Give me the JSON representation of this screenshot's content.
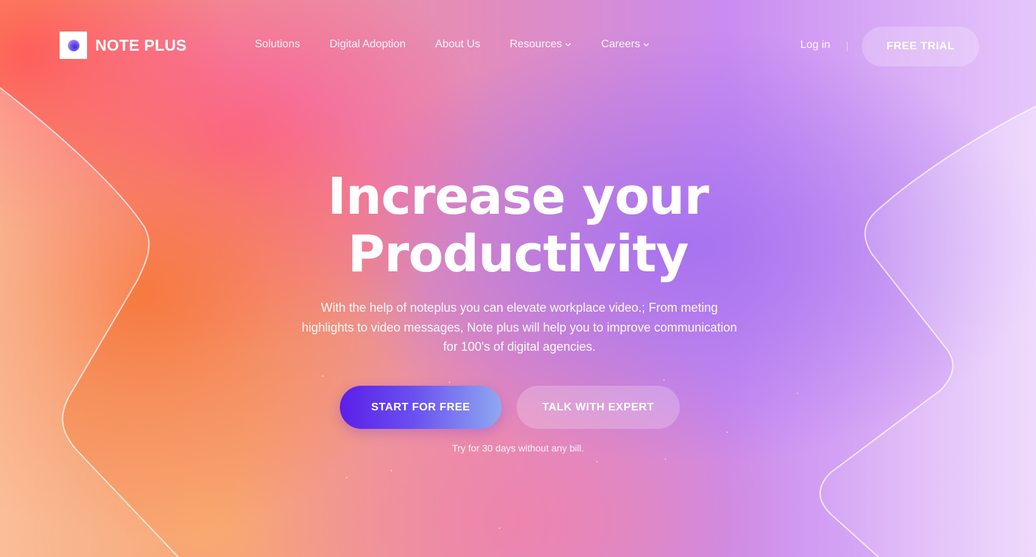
{
  "brand": {
    "name": "NOTE PLUS",
    "logo_icon": "note-plus-logo-icon"
  },
  "nav": {
    "links": [
      {
        "label": "Solutions",
        "has_dropdown": false
      },
      {
        "label": "Digital Adoption",
        "has_dropdown": false
      },
      {
        "label": "About Us",
        "has_dropdown": false
      },
      {
        "label": "Resources",
        "has_dropdown": true
      },
      {
        "label": "Careers",
        "has_dropdown": true
      }
    ],
    "login_label": "Log in",
    "cta_label": "FREE TRIAL"
  },
  "hero": {
    "title_line1": "Increase your",
    "title_line2": "Productivity",
    "description": "With the help of noteplus  you can elevate workplace video.; From meting highlights to video messages, Note plus will help you to improve communication for 100's of digital agencies.",
    "primary_cta": "START FOR FREE",
    "secondary_cta": "TALK WITH EXPERT",
    "note": "Try for 30 days without any bill."
  },
  "colors": {
    "primary_button_start": "#5b1fe8",
    "primary_button_end": "#8fa8f0",
    "text": "#ffffff"
  }
}
